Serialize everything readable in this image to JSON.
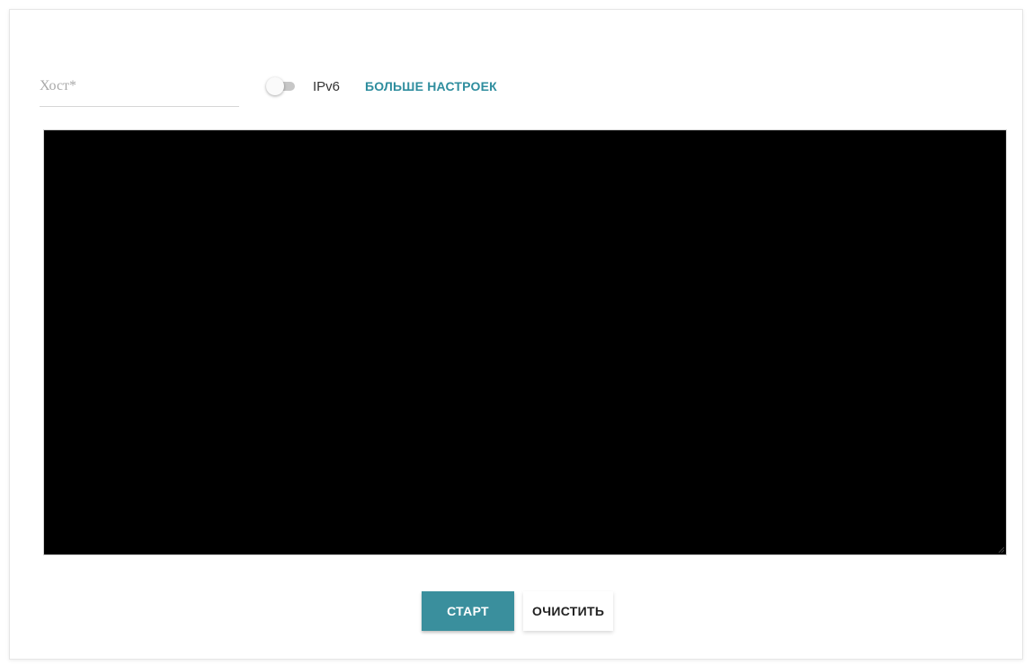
{
  "form": {
    "host": {
      "value": "",
      "placeholder": "Хост*"
    },
    "ipv6": {
      "label": "IPv6",
      "enabled": false
    },
    "more_settings_label": "БОЛЬШЕ НАСТРОЕК"
  },
  "console": {
    "output": "",
    "background": "#000000"
  },
  "actions": {
    "start_label": "СТАРТ",
    "clear_label": "ОЧИСТИТЬ"
  },
  "colors": {
    "accent": "#2e8d9e",
    "start_button": "#3a8f9d"
  },
  "icons": {
    "toggle": "toggle-switch-off",
    "resize": "resize-grip-icon"
  }
}
